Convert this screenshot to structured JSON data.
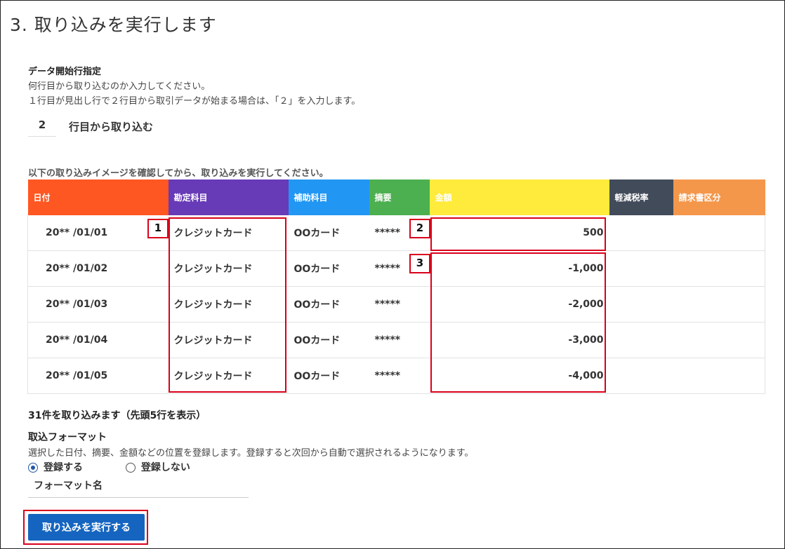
{
  "page": {
    "title": "3. 取り込みを実行します"
  },
  "start_row": {
    "heading": "データ開始行指定",
    "desc1": "何行目から取り込むのか入力してください。",
    "desc2": "１行目が見出し行で２行目から取引データが始まる場合は、「２」を入力します。",
    "value": "2",
    "suffix": "行目から取り込む"
  },
  "preview": {
    "intro": "以下の取り込みイメージを確認してから、取り込みを実行してください。",
    "columns": [
      {
        "label": "日付",
        "color": "#ff5722"
      },
      {
        "label": "勘定科目",
        "color": "#673ab7"
      },
      {
        "label": "補助科目",
        "color": "#2196f3"
      },
      {
        "label": "摘要",
        "color": "#4caf50"
      },
      {
        "label": "金額",
        "color": "#ffeb3b"
      },
      {
        "label": "軽減税率",
        "color": "#424b5a"
      },
      {
        "label": "請求書区分",
        "color": "#f4974b"
      }
    ],
    "rows": [
      {
        "date": "20** /01/01",
        "account": "クレジットカード",
        "sub": "OOカード",
        "memo": "*****",
        "amount": "500",
        "tax": "",
        "invoice": ""
      },
      {
        "date": "20** /01/02",
        "account": "クレジットカード",
        "sub": "OOカード",
        "memo": "*****",
        "amount": "-1,000",
        "tax": "",
        "invoice": ""
      },
      {
        "date": "20** /01/03",
        "account": "クレジットカード",
        "sub": "OOカード",
        "memo": "*****",
        "amount": "-2,000",
        "tax": "",
        "invoice": ""
      },
      {
        "date": "20** /01/04",
        "account": "クレジットカード",
        "sub": "OOカード",
        "memo": "*****",
        "amount": "-3,000",
        "tax": "",
        "invoice": ""
      },
      {
        "date": "20** /01/05",
        "account": "クレジットカード",
        "sub": "OOカード",
        "memo": "*****",
        "amount": "-4,000",
        "tax": "",
        "invoice": ""
      }
    ],
    "count_text": "31件を取り込みます（先頭5行を表示）",
    "callout_labels": [
      "1",
      "2",
      "3"
    ]
  },
  "format": {
    "heading": "取込フォーマット",
    "desc": "選択した日付、摘要、金額などの位置を登録します。登録すると次回から自動で選択されるようになります。",
    "options": [
      "登録する",
      "登録しない"
    ],
    "selected": "登録する",
    "name_placeholder": "フォーマット名"
  },
  "actions": {
    "execute_label": "取り込みを実行する"
  },
  "colors": {
    "callout": "#d9001b",
    "negative_amount": "#e00000",
    "primary": "#1565c0"
  }
}
